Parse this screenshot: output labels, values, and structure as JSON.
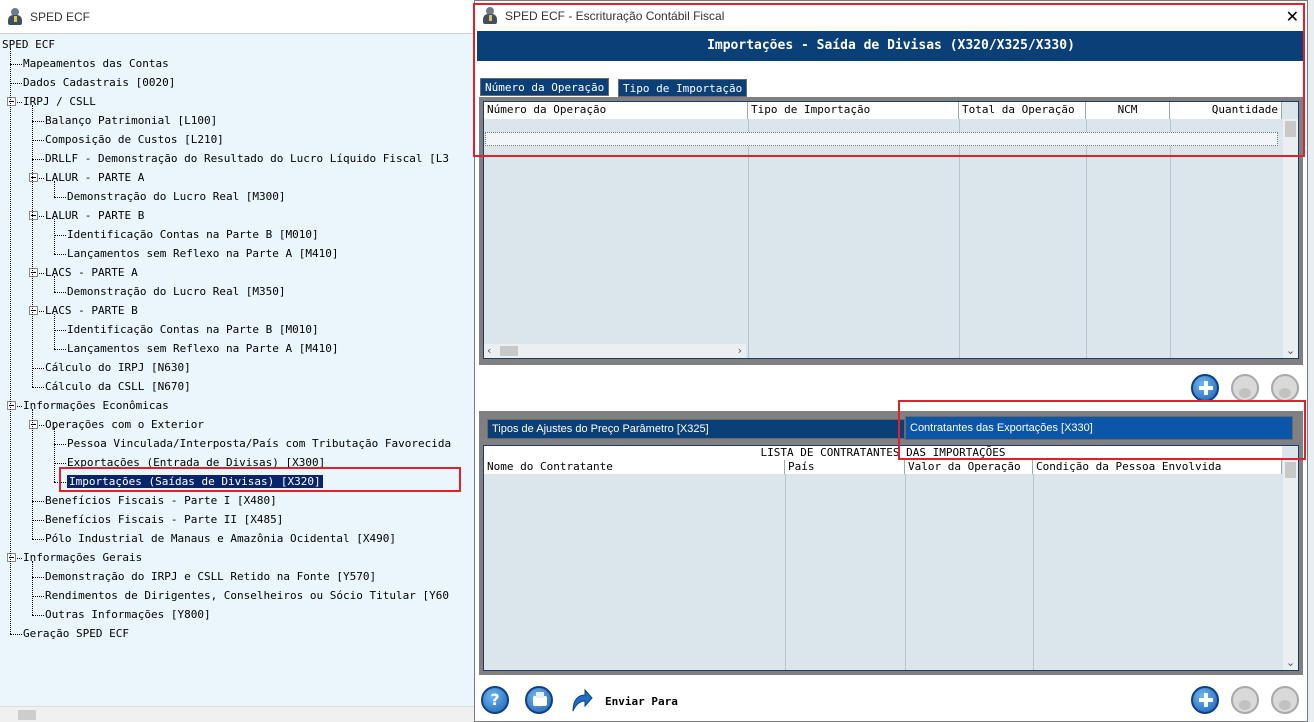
{
  "left_window": {
    "title": "SPED ECF",
    "tree": [
      {
        "label": "SPED ECF",
        "level": 0,
        "expander": false
      },
      {
        "label": "Mapeamentos das Contas",
        "level": 1,
        "expander": false
      },
      {
        "label": "Dados Cadastrais [0020]",
        "level": 1,
        "expander": false
      },
      {
        "label": "IRPJ / CSLL",
        "level": 1,
        "expander": true
      },
      {
        "label": "Balanço Patrimonial [L100]",
        "level": 2,
        "expander": false
      },
      {
        "label": "Composição de Custos [L210]",
        "level": 2,
        "expander": false
      },
      {
        "label": "DRLLF - Demonstração do Resultado do Lucro Líquido Fiscal [L3",
        "level": 2,
        "expander": false
      },
      {
        "label": "LALUR - PARTE A",
        "level": 2,
        "expander": true
      },
      {
        "label": "Demonstração do Lucro Real [M300]",
        "level": 3,
        "expander": false
      },
      {
        "label": "LALUR - PARTE B",
        "level": 2,
        "expander": true
      },
      {
        "label": "Identificação Contas na Parte B [M010]",
        "level": 3,
        "expander": false
      },
      {
        "label": "Lançamentos sem Reflexo na Parte A [M410]",
        "level": 3,
        "expander": false
      },
      {
        "label": "LACS - PARTE A",
        "level": 2,
        "expander": true
      },
      {
        "label": "Demonstração do Lucro Real [M350]",
        "level": 3,
        "expander": false
      },
      {
        "label": "LACS - PARTE B",
        "level": 2,
        "expander": true
      },
      {
        "label": "Identificação Contas na Parte B [M010]",
        "level": 3,
        "expander": false
      },
      {
        "label": "Lançamentos sem Reflexo na Parte A [M410]",
        "level": 3,
        "expander": false
      },
      {
        "label": "Cálculo do IRPJ [N630]",
        "level": 2,
        "expander": false
      },
      {
        "label": "Cálculo da CSLL [N670]",
        "level": 2,
        "expander": false
      },
      {
        "label": "Informações Econômicas",
        "level": 1,
        "expander": true
      },
      {
        "label": "Operações com o Exterior",
        "level": 2,
        "expander": true
      },
      {
        "label": "Pessoa Vinculada/Interposta/País com Tributação Favorecida",
        "level": 3,
        "expander": false
      },
      {
        "label": "Exportações (Entrada de Divisas) [X300]",
        "level": 3,
        "expander": false
      },
      {
        "label": "Importações (Saídas de Divisas) [X320]",
        "level": 3,
        "expander": false,
        "selected": true
      },
      {
        "label": "Benefícios Fiscais - Parte I [X480]",
        "level": 2,
        "expander": false
      },
      {
        "label": "Benefícios Fiscais - Parte II [X485]",
        "level": 2,
        "expander": false
      },
      {
        "label": "Pólo Industrial de Manaus e Amazônia Ocidental [X490]",
        "level": 2,
        "expander": false
      },
      {
        "label": "Informações Gerais",
        "level": 1,
        "expander": true
      },
      {
        "label": "Demonstração do IRPJ e CSLL Retido na Fonte [Y570]",
        "level": 2,
        "expander": false
      },
      {
        "label": "Rendimentos de Dirigentes, Conselheiros ou Sócio Titular [Y60",
        "level": 2,
        "expander": false
      },
      {
        "label": "Outras Informações [Y800]",
        "level": 2,
        "expander": false
      },
      {
        "label": "Geração SPED ECF",
        "level": 1,
        "expander": false
      }
    ]
  },
  "dialog": {
    "title": "SPED ECF  -  Escrituração Contábil Fiscal",
    "banner": "Importações - Saída de Divisas (X320/X325/X330)",
    "top_tabs": [
      "Número da Operação",
      "Tipo de Importação"
    ],
    "top_columns": [
      "Número da Operação",
      "Tipo de Importação",
      "Total da Operação",
      "NCM",
      "Quantidade"
    ],
    "bottom_tabs": [
      "Tipos de Ajustes do Preço Parâmetro [X325]",
      "Contratantes das Exportações [X330]"
    ],
    "bottom_list_title": "LISTA DE CONTRATANTES DAS IMPORTAÇÕES",
    "bottom_columns": [
      "Nome do Contratante",
      "País",
      "Valor da Operação",
      "Condição da Pessoa Envolvida"
    ],
    "send_label": "Enviar Para"
  },
  "colors": {
    "banner": "#0b3f78",
    "selection": "#0a246a",
    "highlight": "#e0202a"
  }
}
